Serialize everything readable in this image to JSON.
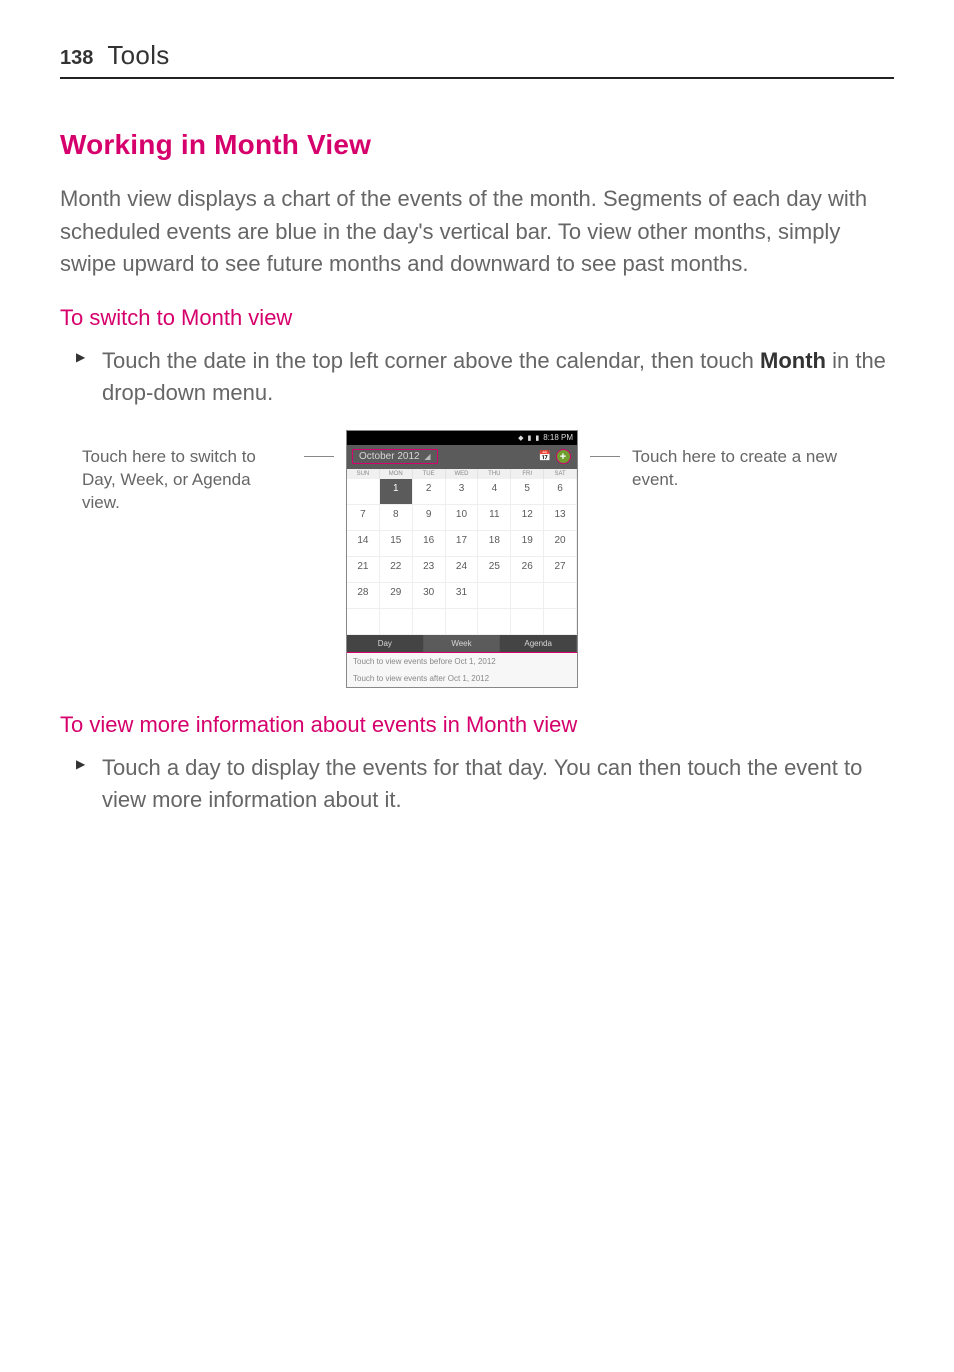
{
  "header": {
    "page_number": "138",
    "title": "Tools"
  },
  "section1": {
    "heading": "Working in Month View",
    "body": "Month view displays a chart of the events of the month. Segments of each day with scheduled events are blue in the day's vertical bar. To view other months, simply swipe upward to see future months and downward to see past months."
  },
  "section2": {
    "heading": "To switch to Month view",
    "bullet_pre": "Touch the date in the top left corner above the calendar, then touch ",
    "bullet_bold": "Month",
    "bullet_post": " in the drop-down menu."
  },
  "figure": {
    "annot_left": "Touch here to switch to Day, Week,  or Agenda view.",
    "annot_right": "Touch here to create a new event.",
    "phone": {
      "status_time": "8:18 PM",
      "month_label": "October 2012",
      "day_headers": [
        "SUN",
        "MON",
        "TUE",
        "WED",
        "THU",
        "FRI",
        "SAT"
      ],
      "weeks": [
        [
          "",
          "1",
          "2",
          "3",
          "4",
          "5",
          "6"
        ],
        [
          "7",
          "8",
          "9",
          "10",
          "11",
          "12",
          "13"
        ],
        [
          "14",
          "15",
          "16",
          "17",
          "18",
          "19",
          "20"
        ],
        [
          "21",
          "22",
          "23",
          "24",
          "25",
          "26",
          "27"
        ],
        [
          "28",
          "29",
          "30",
          "31",
          "",
          "",
          ""
        ],
        [
          "",
          "",
          "",
          "",
          "",
          "",
          ""
        ]
      ],
      "today_cell": "1",
      "tabs": {
        "day": "Day",
        "week": "Week",
        "agenda": "Agenda",
        "active": "Week"
      },
      "hint_before": "Touch to view events before Oct 1, 2012",
      "hint_after": "Touch to view events after Oct 1, 2012"
    }
  },
  "section3": {
    "heading": "To view more information about events in Month view",
    "bullet": "Touch a day to display the events for that day. You can then touch the event to view more information about it."
  }
}
